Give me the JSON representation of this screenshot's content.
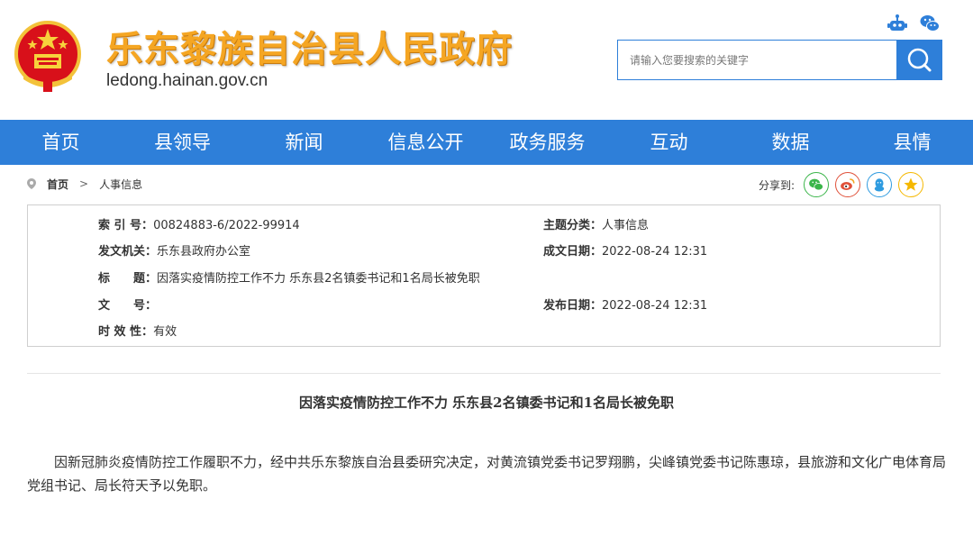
{
  "header": {
    "site_title": "乐东黎族自治县人民政府",
    "site_domain": "ledong.hainan.gov.cn",
    "search_placeholder": "请输入您要搜索的关键字",
    "brand_color": "#2e7fd9",
    "title_color": "#f5a623"
  },
  "nav": {
    "items": [
      "首页",
      "县领导",
      "新闻",
      "信息公开",
      "政务服务",
      "互动",
      "数据",
      "县情"
    ]
  },
  "breadcrumb": {
    "home": "首页",
    "separator": ">",
    "current": "人事信息"
  },
  "share": {
    "label": "分享到:",
    "targets": [
      "wechat-icon",
      "weibo-icon",
      "qq-icon",
      "qzone-icon"
    ]
  },
  "info": {
    "index_label": "索 引 号：",
    "index_value": "00824883-6/2022-99914",
    "topic_label": "主题分类：",
    "topic_value": "人事信息",
    "issuer_label": "发文机关：",
    "issuer_value": "乐东县政府办公室",
    "created_label": "成文日期：",
    "created_value": "2022-08-24 12:31",
    "title_label": "标　　题：",
    "title_value": "因落实疫情防控工作不力 乐东县2名镇委书记和1名局长被免职",
    "docno_label": "文　　号：",
    "docno_value": "",
    "published_label": "发布日期：",
    "published_value": "2022-08-24 12:31",
    "validity_label": "时 效 性：",
    "validity_value": "有效"
  },
  "article": {
    "title": "因落实疫情防控工作不力  乐东县2名镇委书记和1名局长被免职",
    "body": "因新冠肺炎疫情防控工作履职不力，经中共乐东黎族自治县委研究决定，对黄流镇党委书记罗翔鹏，尖峰镇党委书记陈惠琼，县旅游和文化广电体育局党组书记、局长符天予以免职。"
  }
}
